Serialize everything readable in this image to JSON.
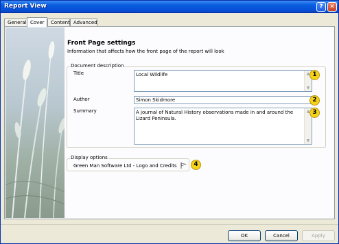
{
  "window": {
    "title": "Report View"
  },
  "tabs": [
    {
      "label": "General"
    },
    {
      "label": "Cover"
    },
    {
      "label": "Content"
    },
    {
      "label": "Advanced"
    }
  ],
  "active_tab": "Cover",
  "page": {
    "heading": "Front Page settings",
    "subtext": "Information that affects how the front page of the report will look"
  },
  "document_description": {
    "legend": "Document description",
    "title_label": "Title",
    "title_value": "Local Wildlife",
    "author_label": "Author",
    "author_value": "Simon Skidmore",
    "summary_label": "Summary",
    "summary_value": "A journal of Natural History observations made in and around the Lizard Peninsula."
  },
  "display_options": {
    "legend": "Display options",
    "value": "Green Man Software Ltd - Logo and Credits"
  },
  "callouts": [
    "1",
    "2",
    "3",
    "4"
  ],
  "buttons": {
    "ok": "OK",
    "cancel": "Cancel",
    "apply": "Apply"
  },
  "icons": {
    "help": "?",
    "close": "✕",
    "scroll_up": "▲",
    "scroll_down": "▼"
  },
  "colors": {
    "titlebar": "#0a5fe0",
    "callout": "#f5d21a",
    "panel": "#fcfcfe",
    "window": "#ece9d8"
  }
}
